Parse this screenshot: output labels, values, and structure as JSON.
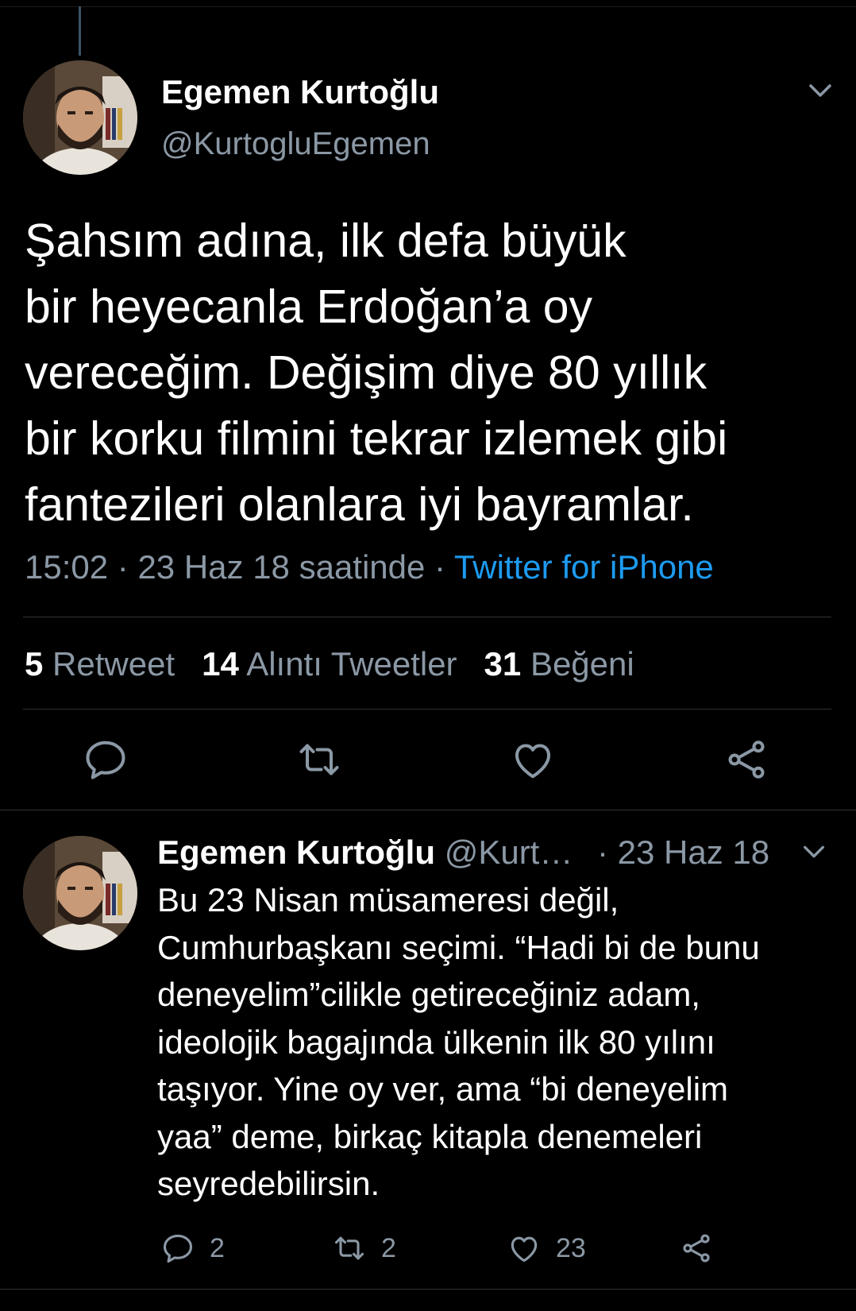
{
  "main_tweet": {
    "author_name": "Egemen Kurtoğlu",
    "author_handle": "@KurtogluEgemen",
    "text_lines": [
      "Şahsım adına, ilk defa büyük",
      "bir heyecanla Erdoğan’a oy",
      "vereceğim. Değişim diye 80 yıllık",
      "bir korku filmini tekrar izlemek gibi",
      "fantezileri olanlara iyi bayramlar."
    ],
    "time": "15:02",
    "date": "23 Haz 18 saatinde",
    "separator": "·",
    "source": "Twitter for iPhone",
    "stats": {
      "retweet_count": "5",
      "retweet_label": "Retweet",
      "quote_count": "14",
      "quote_label": "Alıntı Tweetler",
      "like_count": "31",
      "like_label": "Beğeni"
    },
    "actions": [
      "reply-icon",
      "retweet-icon",
      "like-icon",
      "share-icon"
    ]
  },
  "reply_tweet": {
    "author_name": "Egemen Kurtoğlu",
    "author_handle_truncated": "@Kurt…",
    "date": "· 23 Haz 18",
    "text_lines": [
      "Bu 23 Nisan müsameresi değil,",
      "Cumhurbaşkanı seçimi. “Hadi bi de bunu",
      "deneyelim”cilikle getireceğiniz adam,",
      "ideolojik bagajında ülkenin ilk 80 yılını",
      "taşıyor. Yine oy ver, ama “bi deneyelim",
      "yaa” deme, birkaç kitapla denemeleri",
      "seyredebilirsin."
    ],
    "reply_count": "2",
    "retweet_count": "2",
    "like_count": "23"
  },
  "colors": {
    "background": "#000000",
    "secondary_text": "#8b98a5",
    "link": "#1d9bf0",
    "divider": "#2f3336"
  }
}
